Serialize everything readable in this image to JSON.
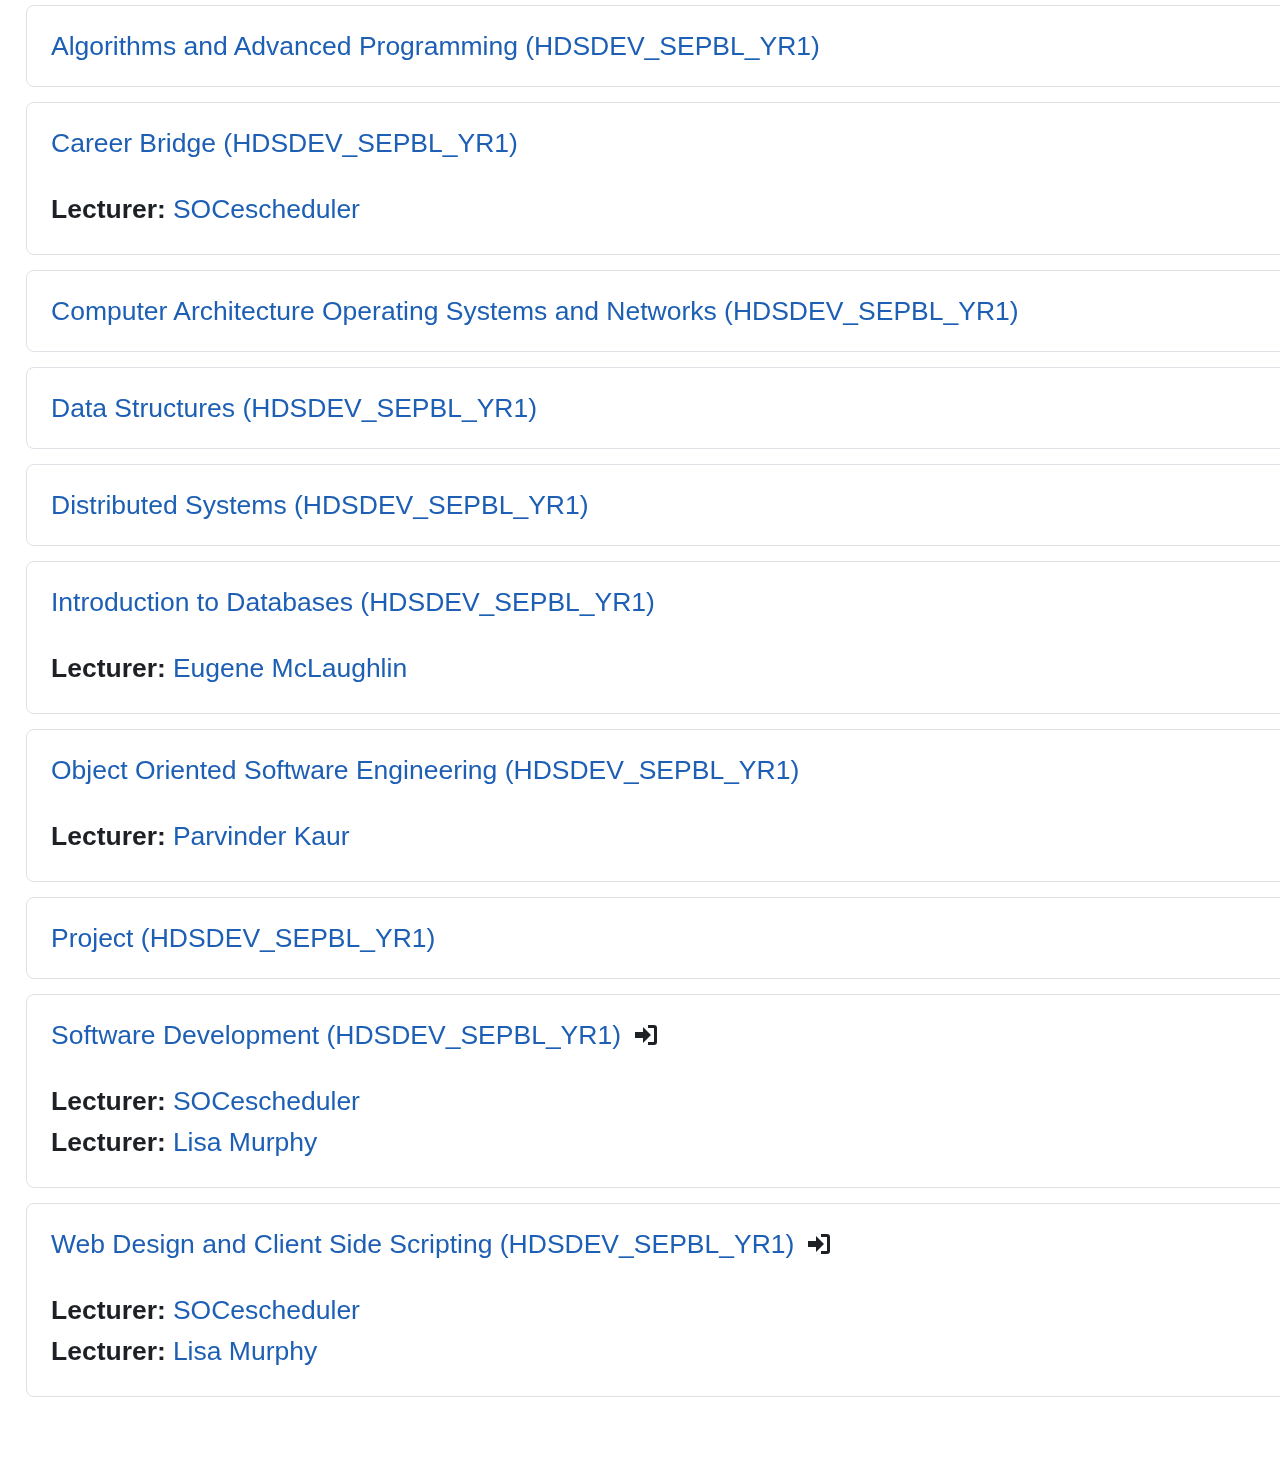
{
  "courses": [
    {
      "title": "Algorithms and Advanced Programming (HDSDEV_SEPBL_YR1)",
      "enrol_icon": false
    },
    {
      "title": "Career Bridge (HDSDEV_SEPBL_YR1)",
      "enrol_icon": false,
      "lecturers": [
        {
          "label": "Lecturer:",
          "name": "SOCescheduler"
        }
      ]
    },
    {
      "title": "Computer Architecture Operating Systems and Networks (HDSDEV_SEPBL_YR1)",
      "enrol_icon": false
    },
    {
      "title": "Data Structures (HDSDEV_SEPBL_YR1)",
      "enrol_icon": false
    },
    {
      "title": "Distributed Systems (HDSDEV_SEPBL_YR1)",
      "enrol_icon": false
    },
    {
      "title": "Introduction to Databases (HDSDEV_SEPBL_YR1)",
      "enrol_icon": false,
      "lecturers": [
        {
          "label": "Lecturer:",
          "name": "Eugene McLaughlin"
        }
      ]
    },
    {
      "title": "Object Oriented Software Engineering (HDSDEV_SEPBL_YR1)",
      "enrol_icon": false,
      "lecturers": [
        {
          "label": "Lecturer:",
          "name": "Parvinder Kaur"
        }
      ]
    },
    {
      "title": "Project (HDSDEV_SEPBL_YR1)",
      "enrol_icon": false
    },
    {
      "title": "Software Development (HDSDEV_SEPBL_YR1)",
      "enrol_icon": true,
      "lecturers": [
        {
          "label": "Lecturer:",
          "name": "SOCescheduler"
        },
        {
          "label": "Lecturer:",
          "name": "Lisa Murphy"
        }
      ]
    },
    {
      "title": "Web Design and Client Side Scripting (HDSDEV_SEPBL_YR1)",
      "enrol_icon": true,
      "lecturers": [
        {
          "label": "Lecturer:",
          "name": "SOCescheduler"
        },
        {
          "label": "Lecturer:",
          "name": "Lisa Murphy"
        }
      ]
    }
  ]
}
